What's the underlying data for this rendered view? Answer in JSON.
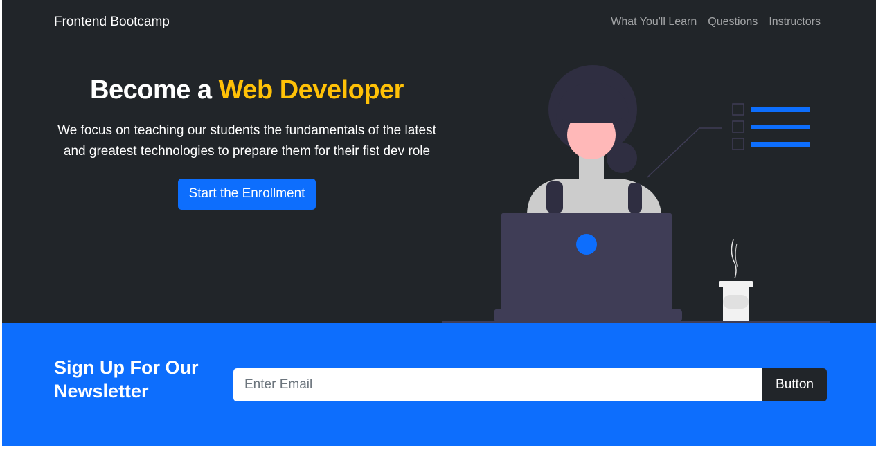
{
  "navbar": {
    "brand": "Frontend Bootcamp",
    "links": [
      "What You'll Learn",
      "Questions",
      "Instructors"
    ]
  },
  "hero": {
    "title_prefix": "Become a ",
    "title_accent": "Web Developer",
    "description": "We focus on teaching our students the fundamentals of the latest and greatest technologies to prepare them for their fist dev role",
    "cta_label": "Start the Enrollment",
    "illustration": "woman-at-laptop-illustration"
  },
  "newsletter": {
    "title": "Sign Up For Our Newsletter",
    "email_placeholder": "Enter Email",
    "button_label": "Button"
  },
  "colors": {
    "hero_bg": "#212529",
    "accent_yellow": "#ffc107",
    "primary_blue": "#0d6efd",
    "dark_button": "#212529"
  }
}
